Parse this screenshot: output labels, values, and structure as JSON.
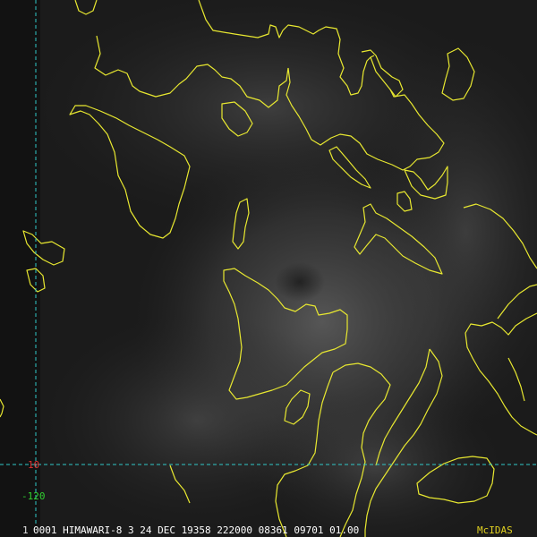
{
  "satellite_image": {
    "header": "0001 HIMAWARI-8   3 24 DEC 19358 222000 08361 09701 01.00",
    "frame_number": "1",
    "logo": "McIDAS",
    "latitude_label": "10",
    "longitude_label": "-120",
    "colors": {
      "coastline": "#e8e830",
      "grid": "#30c8c8",
      "latitude_text": "#e03030",
      "longitude_text": "#30d030",
      "logo_text": "#e0d020",
      "background": "#111111"
    }
  }
}
